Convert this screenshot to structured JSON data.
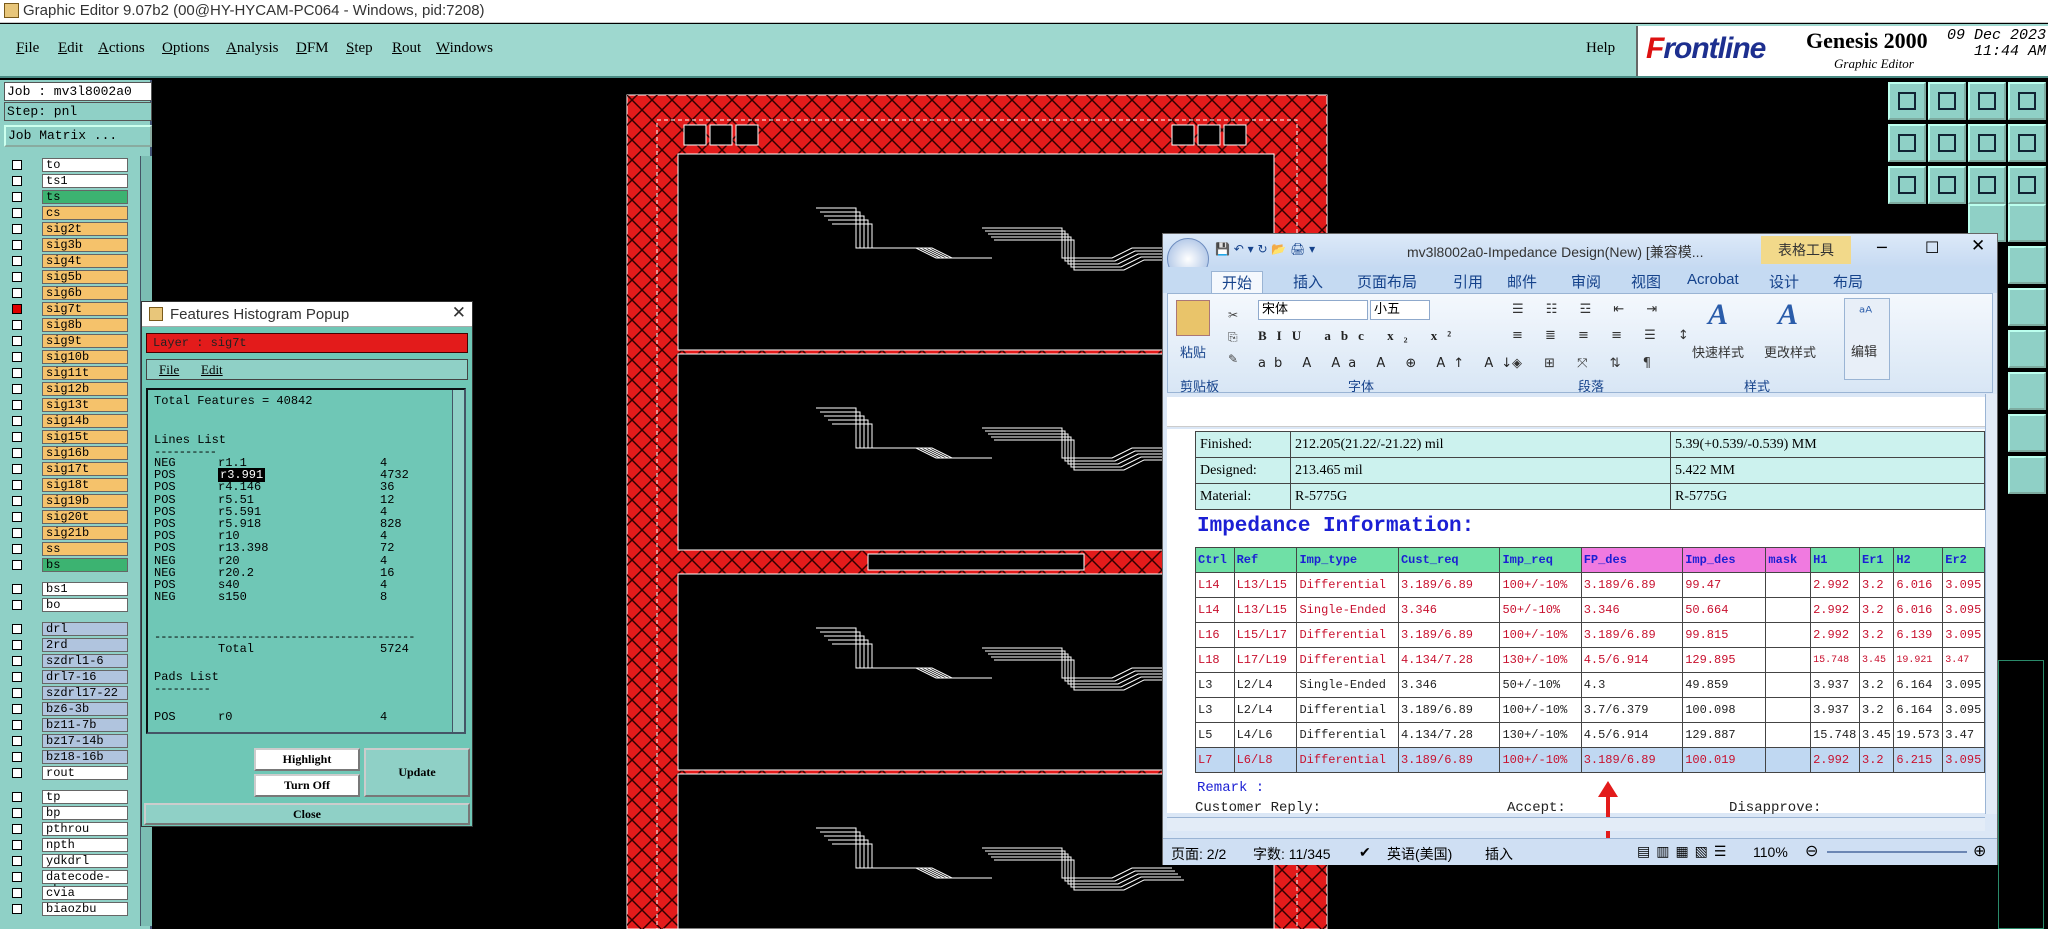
{
  "window": {
    "title": "Graphic Editor 9.07b2 (00@HY-HYCAM-PC064 - Windows, pid:7208)"
  },
  "menu": {
    "items": [
      {
        "u": "F",
        "rest": "ile"
      },
      {
        "u": "E",
        "rest": "dit"
      },
      {
        "u": "A",
        "rest": "ctions"
      },
      {
        "u": "O",
        "rest": "ptions"
      },
      {
        "u": "A",
        "rest": "nalysis"
      },
      {
        "u": "D",
        "rest": "FM"
      },
      {
        "u": "S",
        "rest": "tep"
      },
      {
        "u": "R",
        "rest": "out"
      },
      {
        "u": "W",
        "rest": "indows"
      }
    ],
    "help": "Help"
  },
  "logo": {
    "brand_prefix": "F",
    "brand_rest": "rontline",
    "product": "Genesis 2000",
    "subtitle": "Graphic Editor",
    "date": "09 Dec 2023",
    "time": "11:44 AM"
  },
  "job": {
    "job": "Job : mv3l8002a0",
    "step": "Step: pnl",
    "matrix": "Job Matrix ..."
  },
  "layers": [
    {
      "name": "to",
      "color": "#ffffff",
      "on": false
    },
    {
      "name": "ts1",
      "color": "#ffffff",
      "on": false
    },
    {
      "name": "ts",
      "color": "#3cb371",
      "on": false
    },
    {
      "name": "cs",
      "color": "#f5c26b",
      "on": false
    },
    {
      "name": "sig2t",
      "color": "#f5c26b",
      "on": false
    },
    {
      "name": "sig3b",
      "color": "#f5c26b",
      "on": false
    },
    {
      "name": "sig4t",
      "color": "#f5c26b",
      "on": false
    },
    {
      "name": "sig5b",
      "color": "#f5c26b",
      "on": false
    },
    {
      "name": "sig6b",
      "color": "#f5c26b",
      "on": false
    },
    {
      "name": "sig7t",
      "color": "#f5c26b",
      "on": true
    },
    {
      "name": "sig8b",
      "color": "#f5c26b",
      "on": false
    },
    {
      "name": "sig9t",
      "color": "#f5c26b",
      "on": false
    },
    {
      "name": "sig10b",
      "color": "#f5c26b",
      "on": false
    },
    {
      "name": "sig11t",
      "color": "#f5c26b",
      "on": false
    },
    {
      "name": "sig12b",
      "color": "#f5c26b",
      "on": false
    },
    {
      "name": "sig13t",
      "color": "#f5c26b",
      "on": false
    },
    {
      "name": "sig14b",
      "color": "#f5c26b",
      "on": false
    },
    {
      "name": "sig15t",
      "color": "#f5c26b",
      "on": false
    },
    {
      "name": "sig16b",
      "color": "#f5c26b",
      "on": false
    },
    {
      "name": "sig17t",
      "color": "#f5c26b",
      "on": false
    },
    {
      "name": "sig18t",
      "color": "#f5c26b",
      "on": false
    },
    {
      "name": "sig19b",
      "color": "#f5c26b",
      "on": false
    },
    {
      "name": "sig20t",
      "color": "#f5c26b",
      "on": false
    },
    {
      "name": "sig21b",
      "color": "#f5c26b",
      "on": false
    },
    {
      "name": "ss",
      "color": "#f5c26b",
      "on": false
    },
    {
      "name": "bs",
      "color": "#3cb371",
      "on": false
    },
    {
      "name": "bs1",
      "color": "#ffffff",
      "on": false
    },
    {
      "name": "bo",
      "color": "#ffffff",
      "on": false
    },
    {
      "name": "drl",
      "color": "#b0c4de",
      "on": false
    },
    {
      "name": "2rd",
      "color": "#b0c4de",
      "on": false
    },
    {
      "name": "szdrl1-6",
      "color": "#b0c4de",
      "on": false
    },
    {
      "name": "drl7-16",
      "color": "#b0c4de",
      "on": false
    },
    {
      "name": "szdrl17-22",
      "color": "#b0c4de",
      "on": false
    },
    {
      "name": "bz6-3b",
      "color": "#b0c4de",
      "on": false
    },
    {
      "name": "bz11-7b",
      "color": "#b0c4de",
      "on": false
    },
    {
      "name": "bz17-14b",
      "color": "#b0c4de",
      "on": false
    },
    {
      "name": "bz18-16b",
      "color": "#b0c4de",
      "on": false
    },
    {
      "name": "rout",
      "color": "#ffffff",
      "on": false
    },
    {
      "name": "tp",
      "color": "#ffffff",
      "on": false
    },
    {
      "name": "bp",
      "color": "#ffffff",
      "on": false
    },
    {
      "name": "pthrou",
      "color": "#ffffff",
      "on": false
    },
    {
      "name": "npth",
      "color": "#ffffff",
      "on": false
    },
    {
      "name": "ydkdrl",
      "color": "#ffffff",
      "on": false
    },
    {
      "name": "datecode-pbe",
      "color": "#ffffff",
      "on": false
    },
    {
      "name": "cvia",
      "color": "#ffffff",
      "on": false
    },
    {
      "name": "biaozbu",
      "color": "#ffffff",
      "on": false
    }
  ],
  "histogram": {
    "title": "Features Histogram Popup",
    "layer": "Layer :  sig7t",
    "menu_file": "File",
    "menu_edit": "Edit",
    "total": "Total Features = 40842",
    "lines_title": "Lines List",
    "lines": [
      {
        "pol": "NEG",
        "sym": "r1.1",
        "cnt": "4"
      },
      {
        "pol": "POS",
        "sym": "r3.991",
        "cnt": "4732"
      },
      {
        "pol": "POS",
        "sym": "r4.146",
        "cnt": "36"
      },
      {
        "pol": "POS",
        "sym": "r5.51",
        "cnt": "12"
      },
      {
        "pol": "POS",
        "sym": "r5.591",
        "cnt": "4"
      },
      {
        "pol": "POS",
        "sym": "r5.918",
        "cnt": "828"
      },
      {
        "pol": "POS",
        "sym": "r10",
        "cnt": "4"
      },
      {
        "pol": "POS",
        "sym": "r13.398",
        "cnt": "72"
      },
      {
        "pol": "NEG",
        "sym": "r20",
        "cnt": "4"
      },
      {
        "pol": "NEG",
        "sym": "r20.2",
        "cnt": "16"
      },
      {
        "pol": "POS",
        "sym": "s40",
        "cnt": "4"
      },
      {
        "pol": "NEG",
        "sym": "s150",
        "cnt": "8"
      }
    ],
    "total_label": "Total",
    "total_count": "5724",
    "pads_title": "Pads List",
    "pad_row": {
      "pol": "POS",
      "sym": "r0",
      "cnt": "4"
    },
    "highlight": "Highlight",
    "turnoff": "Turn Off",
    "update": "Update",
    "close": "Close"
  },
  "word": {
    "title": "mv3l8002a0-Impedance Design(New) [兼容模...",
    "context_tab": "表格工具",
    "tabs": [
      "开始",
      "插入",
      "页面布局",
      "引用",
      "邮件",
      "审阅",
      "视图",
      "Acrobat",
      "设计",
      "布局"
    ],
    "font_name": "宋体",
    "font_size": "小五",
    "groups": {
      "clipboard": "剪贴板",
      "font": "字体",
      "paragraph": "段落",
      "styles": "样式"
    },
    "paste": "粘贴",
    "quick_styles": "快速样式",
    "change_styles": "更改样式",
    "editing": "编辑",
    "info_rows": [
      [
        "Finished:",
        "212.205(21.22/-21.22) mil",
        "5.39(+0.539/-0.539) MM"
      ],
      [
        "Designed:",
        "213.465 mil",
        "5.422 MM"
      ],
      [
        "Material:",
        "R-5775G",
        "R-5775G"
      ]
    ],
    "heading": "Impedance Information:",
    "headers": [
      "Ctrl",
      "Ref",
      "Imp_type",
      "Cust_req",
      "Imp_req",
      "FP_des",
      "Imp_des",
      "mask",
      "H1",
      "Er1",
      "H2",
      "Er2"
    ],
    "rows": [
      [
        "L14",
        "L13/L15",
        "Differential",
        "3.189/6.89",
        "100+/-10%",
        "3.189/6.89",
        "99.47",
        "",
        "2.992",
        "3.2",
        "6.016",
        "3.095"
      ],
      [
        "L14",
        "L13/L15",
        "Single-Ended",
        "3.346",
        "50+/-10%",
        "3.346",
        "50.664",
        "",
        "2.992",
        "3.2",
        "6.016",
        "3.095"
      ],
      [
        "L16",
        "L15/L17",
        "Differential",
        "3.189/6.89",
        "100+/-10%",
        "3.189/6.89",
        "99.815",
        "",
        "2.992",
        "3.2",
        "6.139",
        "3.095"
      ],
      [
        "L18",
        "L17/L19",
        "Differential",
        "4.134/7.28",
        "130+/-10%",
        "4.5/6.914",
        "129.895",
        "",
        "15.748",
        "3.45",
        "19.921",
        "3.47"
      ],
      [
        "L3",
        "L2/L4",
        "Single-Ended",
        "3.346",
        "50+/-10%",
        "4.3",
        "49.859",
        "",
        "3.937",
        "3.2",
        "6.164",
        "3.095"
      ],
      [
        "L3",
        "L2/L4",
        "Differential",
        "3.189/6.89",
        "100+/-10%",
        "3.7/6.379",
        "100.098",
        "",
        "3.937",
        "3.2",
        "6.164",
        "3.095"
      ],
      [
        "L5",
        "L4/L6",
        "Differential",
        "4.134/7.28",
        "130+/-10%",
        "4.5/6.914",
        "129.887",
        "",
        "15.748",
        "3.45",
        "19.573",
        "3.47"
      ],
      [
        "L7",
        "L6/L8",
        "Differential",
        "3.189/6.89",
        "100+/-10%",
        "3.189/6.89",
        "100.019",
        "",
        "2.992",
        "3.2",
        "6.215",
        "3.095"
      ]
    ],
    "remark": "Remark :",
    "customer_reply": "Customer Reply:",
    "accept": "Accept:",
    "disapprove": "Disapprove:",
    "status_page": "页面: 2/2",
    "status_words": "字数: 11/345",
    "status_lang": "英语(美国)",
    "status_insert": "插入",
    "zoom": "110%"
  },
  "colors": {
    "panel": "#9ed8cf",
    "board_red": "#e31b1b",
    "layer_orange": "#f5c26b",
    "layer_green": "#3cb371",
    "word_blue": "#15428b"
  }
}
